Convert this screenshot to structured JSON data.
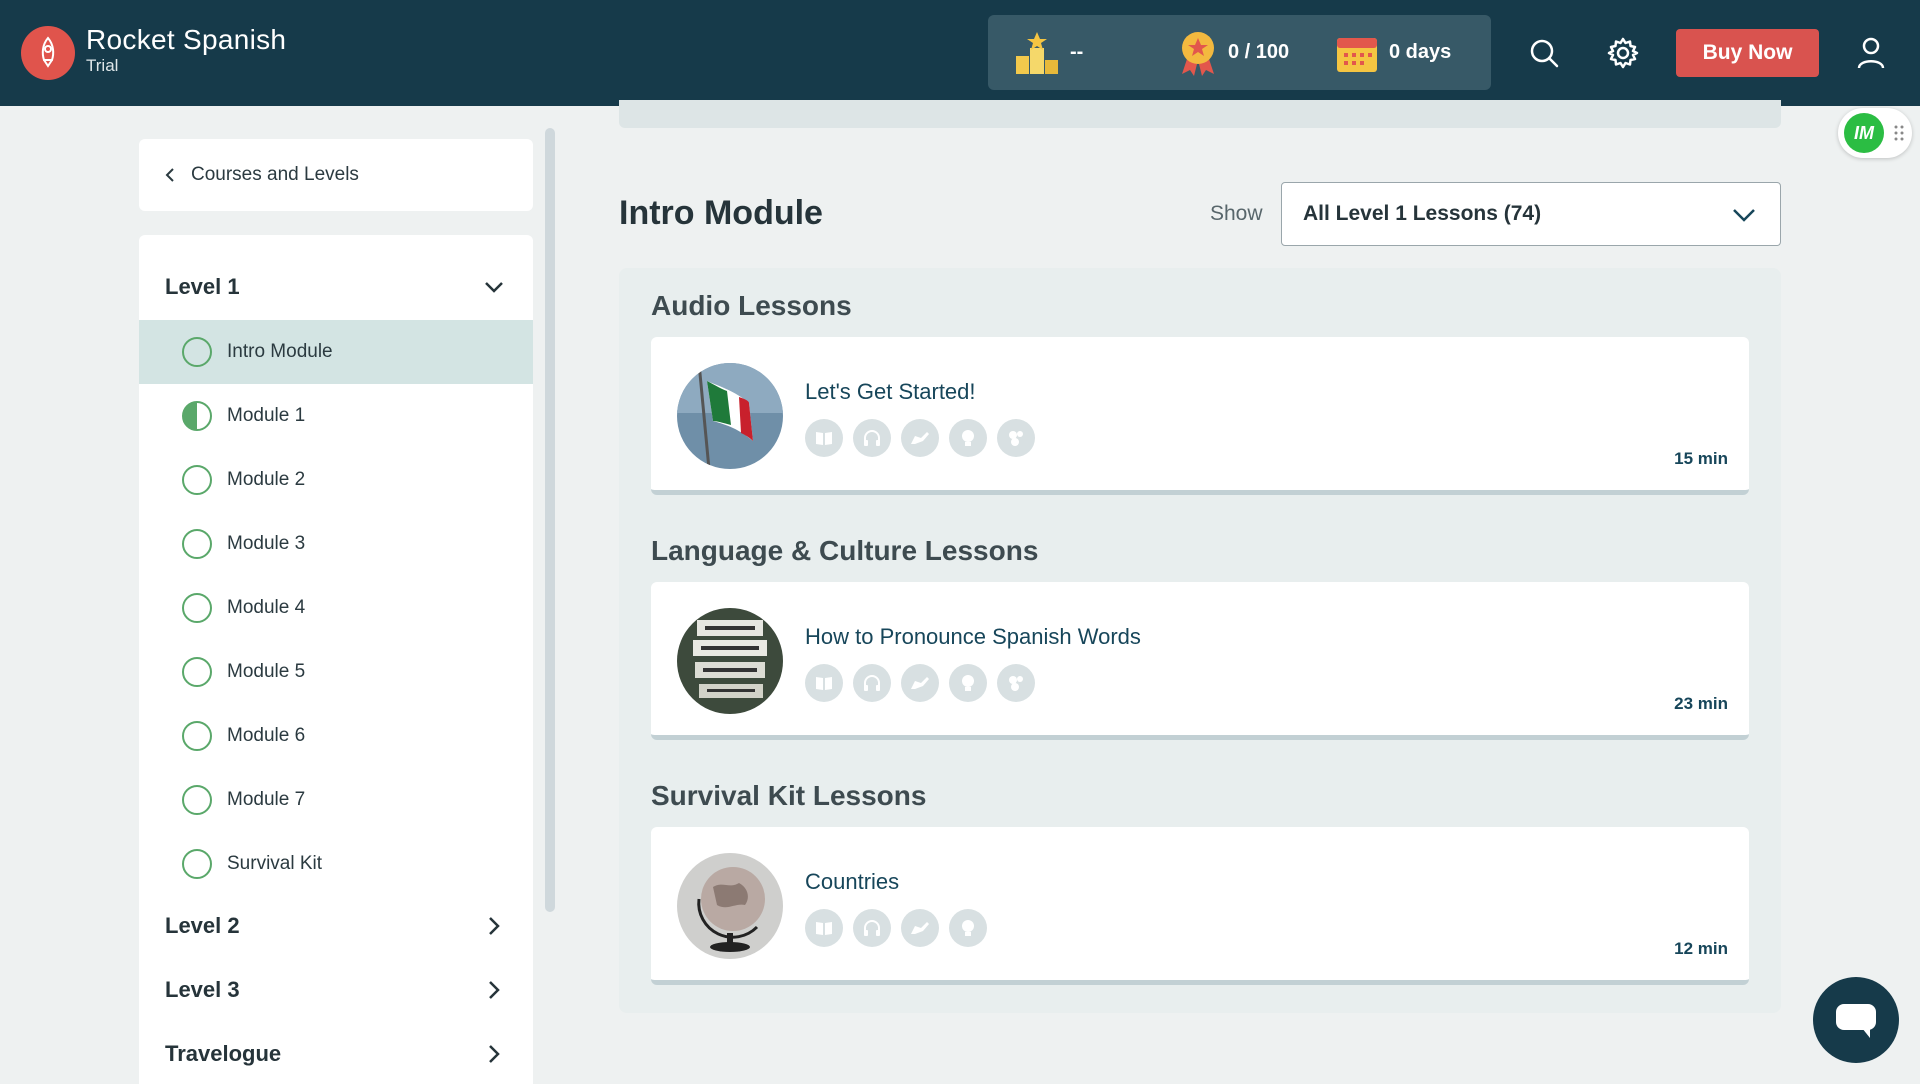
{
  "header": {
    "brand_name": "Rocket Spanish",
    "brand_sub": "Trial",
    "rank_value": "--",
    "points_value": "0 / 100",
    "streak_value": "0 days",
    "buy_label": "Buy Now"
  },
  "sidebar": {
    "back_label": "Courses and Levels",
    "levels": [
      {
        "label": "Level 1",
        "expanded": true
      },
      {
        "label": "Level 2",
        "expanded": false
      },
      {
        "label": "Level 3",
        "expanded": false
      },
      {
        "label": "Travelogue",
        "expanded": false
      }
    ],
    "modules": [
      {
        "label": "Intro Module",
        "progress": 0,
        "active": true
      },
      {
        "label": "Module 1",
        "progress": 0.5,
        "active": false
      },
      {
        "label": "Module 2",
        "progress": 0,
        "active": false
      },
      {
        "label": "Module 3",
        "progress": 0,
        "active": false
      },
      {
        "label": "Module 4",
        "progress": 0,
        "active": false
      },
      {
        "label": "Module 5",
        "progress": 0,
        "active": false
      },
      {
        "label": "Module 6",
        "progress": 0,
        "active": false
      },
      {
        "label": "Module 7",
        "progress": 0,
        "active": false
      },
      {
        "label": "Survival Kit",
        "progress": 0,
        "active": false
      }
    ]
  },
  "main": {
    "title": "Intro Module",
    "show_label": "Show",
    "filter_value": "All Level 1 Lessons (74)",
    "sections": [
      {
        "title": "Audio Lessons",
        "lesson": {
          "title": "Let's Get Started!",
          "duration": "15 min",
          "icon_count": 5
        }
      },
      {
        "title": "Language & Culture Lessons",
        "lesson": {
          "title": "How to Pronounce Spanish Words",
          "duration": "23 min",
          "icon_count": 5
        }
      },
      {
        "title": "Survival Kit Lessons",
        "lesson": {
          "title": "Countries",
          "duration": "12 min",
          "icon_count": 4
        }
      }
    ]
  },
  "badge": {
    "label": "IM"
  },
  "colors": {
    "header": "#163a4a",
    "accent": "#d9534f",
    "progress_green": "#5aa86a",
    "active_row": "#d3e4e3"
  }
}
